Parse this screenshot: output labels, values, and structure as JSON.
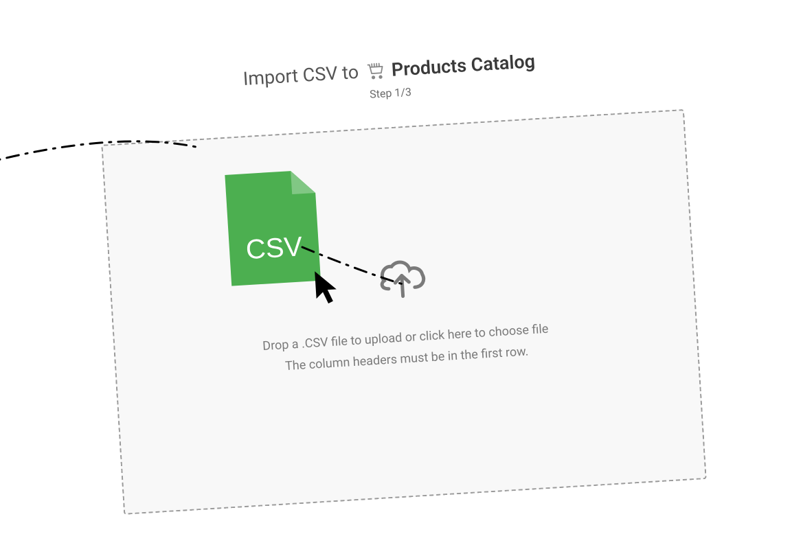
{
  "header": {
    "title_prefix": "Import CSV to",
    "cart_icon": "cart-icon",
    "catalog_name": "Products Catalog",
    "step_label": "Step 1/3"
  },
  "dropzone": {
    "upload_icon": "cloud-upload-icon",
    "line1": "Drop a .CSV file to upload or click here to choose file",
    "line2": "The column headers must be in the first row."
  },
  "dragged_file": {
    "label": "CSV",
    "color": "#4CAF50"
  }
}
